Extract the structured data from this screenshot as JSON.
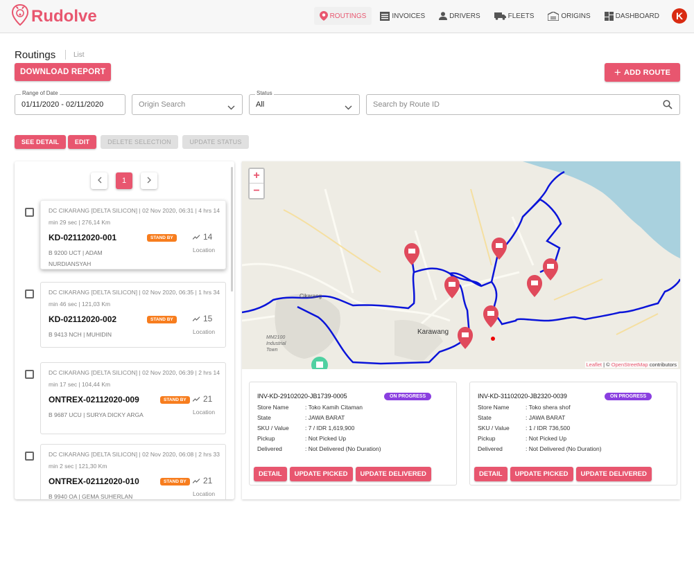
{
  "app": {
    "name": "Rudolve",
    "avatar_letter": "K",
    "accent": "#e8566f"
  },
  "nav": [
    {
      "label": "ROUTINGS",
      "icon": "pin-icon",
      "active": true
    },
    {
      "label": "INVOICES",
      "icon": "invoice-icon"
    },
    {
      "label": "DRIVERS",
      "icon": "person-icon"
    },
    {
      "label": "FLEETS",
      "icon": "truck-icon"
    },
    {
      "label": "ORIGINS",
      "icon": "warehouse-icon"
    },
    {
      "label": "DASHBOARD",
      "icon": "dashboard-icon"
    }
  ],
  "page": {
    "title": "Routings",
    "subtitle": "List"
  },
  "actions": {
    "download": "DOWNLOAD REPORT",
    "add_route": "ADD ROUTE"
  },
  "filters": {
    "date_label": "Range of Date",
    "date_value": "01/11/2020 - 02/11/2020",
    "origin_placeholder": "Origin Search",
    "status_label": "Status",
    "status_value": "All",
    "search_placeholder": "Search by Route ID"
  },
  "toolbar": {
    "see_detail": "SEE DETAIL",
    "edit": "EDIT",
    "delete_selection": "DELETE SELECTION",
    "update_status": "UPDATE STATUS"
  },
  "pagination": {
    "current": "1"
  },
  "routes": [
    {
      "meta": "DC CIKARANG [DELTA SILICON] | 02 Nov 2020, 06:31 | 4 hrs 14 min 29 sec | 276,14 Km",
      "id": "KD-02112020-001",
      "badge": "STAND BY",
      "driver": "B 9200 UCT | ADAM NURDIANSYAH",
      "count": "14",
      "count_label": "Location"
    },
    {
      "meta": "DC CIKARANG [DELTA SILICON] | 02 Nov 2020, 06:35 | 1 hrs 34 min 46 sec | 121,03 Km",
      "id": "KD-02112020-002",
      "badge": "STAND BY",
      "driver": "B 9413 NCH | MUHIDIN",
      "count": "15",
      "count_label": "Location"
    },
    {
      "meta": "DC CIKARANG [DELTA SILICON] | 02 Nov 2020, 06:39 | 2 hrs 14 min 17 sec | 104,44 Km",
      "id": "ONTREX-02112020-009",
      "badge": "STAND BY",
      "driver": "B 9687 UCU | SURYA DICKY ARGA",
      "count": "21",
      "count_label": "Location"
    },
    {
      "meta": "DC CIKARANG [DELTA SILICON] | 02 Nov 2020, 06:08 | 2 hrs 33 min 2 sec | 121,30 Km",
      "id": "ONTREX-02112020-010",
      "badge": "STAND BY",
      "driver": "B 9940 OA | GEMA SUHERLAN",
      "count": "21",
      "count_label": "Location"
    }
  ],
  "map": {
    "labels": {
      "city": "Karawang",
      "area": "MM2100 Industrial Town",
      "town": "Cikarang"
    },
    "attribution": {
      "leaflet": "Leaflet",
      "sep": " | © ",
      "osm": "OpenStreetMap",
      "suffix": " contributors"
    },
    "zoom_in": "+",
    "zoom_out": "−"
  },
  "invoices": [
    {
      "id": "INV-KD-29102020-JB1739-0005",
      "status": "ON PROGRESS",
      "rows": [
        {
          "k": "Store Name",
          "v": ": Toko Kamih Citaman"
        },
        {
          "k": "State",
          "v": ": JAWA BARAT"
        },
        {
          "k": "SKU / Value",
          "v": ": 7 / IDR 1,619,900"
        },
        {
          "k": "Pickup",
          "v": ": Not Picked Up"
        },
        {
          "k": "Delivered",
          "v": ": Not Delivered (No Duration)"
        }
      ],
      "btn_detail": "DETAIL",
      "btn_picked": "UPDATE PICKED",
      "btn_delivered": "UPDATE DELIVERED"
    },
    {
      "id": "INV-KD-31102020-JB2320-0039",
      "status": "ON PROGRESS",
      "rows": [
        {
          "k": "Store Name",
          "v": ": Toko shera shof"
        },
        {
          "k": "State",
          "v": ": JAWA BARAT"
        },
        {
          "k": "SKU / Value",
          "v": ": 1 / IDR 736,500"
        },
        {
          "k": "Pickup",
          "v": ": Not Picked Up"
        },
        {
          "k": "Delivered",
          "v": ": Not Delivered (No Duration)"
        }
      ],
      "btn_detail": "DETAIL",
      "btn_picked": "UPDATE PICKED",
      "btn_delivered": "UPDATE DELIVERED"
    }
  ]
}
